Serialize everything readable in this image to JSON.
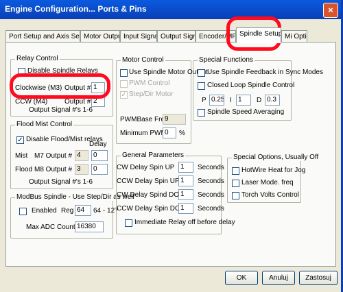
{
  "window": {
    "title": "Engine Configuration... Ports & Pins",
    "close_glyph": "×"
  },
  "tabs": [
    "Port Setup and Axis Selection",
    "Motor Outputs",
    "Input Signals",
    "Output Signals",
    "Encoder/MPG's",
    "Spindle Setup",
    "Mill Options"
  ],
  "tabs_visible": [
    "Port Setup and Axis Selection",
    "Motor Outputs",
    "Input Signals",
    "Output Signals",
    "Encoder/MP",
    "Spindle Setup",
    "Mi Options"
  ],
  "relay_control": {
    "title": "Relay Control",
    "disable_label": "Disable Spindle Relays",
    "cw_label": "Clockwise (M3)",
    "cw_output_label": "Output #",
    "cw_output_value": "1",
    "ccw_label": "CCW (M4)",
    "ccw_output_label": "Output #",
    "ccw_output_value": "2",
    "signals_label": "Output Signal #'s 1-6"
  },
  "flood_mist": {
    "title": "Flood Mist Control",
    "disable_label": "Disable Flood/Mist relays",
    "delay_label": "Delay",
    "mist_label": "Mist",
    "mist_code": "M7 Output #",
    "mist_output": "4",
    "mist_delay": "0",
    "flood_label": "Flood",
    "flood_code": "M8 Output #",
    "flood_output": "3",
    "flood_delay": "0",
    "signals_label": "Output Signal #'s 1-6"
  },
  "modbus": {
    "title": "ModBus Spindle - Use Step/Dir as well",
    "enabled_label": "Enabled",
    "reg_label": "Reg",
    "reg_value": "64",
    "reg_range": "64 - 127",
    "max_adc_label": "Max ADC Count",
    "max_adc_value": "16380"
  },
  "motor_control": {
    "title": "Motor Control",
    "use_motor_label": "Use Spindle Motor Output",
    "pwm_label": "PWM Control",
    "stepdir_label": "Step/Dir Motor",
    "pwm_base_label": "PWMBase Freq.",
    "pwm_base_value": "9",
    "min_pwm_label": "Minimum PWM",
    "min_pwm_value": "0",
    "min_pwm_unit": "%"
  },
  "special_functions": {
    "title": "Special Functions",
    "feedback_label": "Use Spindle Feedback in Sync Modes",
    "closed_loop_label": "Closed Loop Spindle Control",
    "p_label": "P",
    "p_value": "0.25",
    "i_label": "I",
    "i_value": "1",
    "d_label": "D",
    "d_value": "0.3",
    "averaging_label": "Spindle Speed Averaging"
  },
  "general_params": {
    "title": "General Parameters",
    "rows": [
      {
        "label": "CW Delay Spin UP",
        "value": "1",
        "unit": "Seconds"
      },
      {
        "label": "CCW Delay Spin UP",
        "value": "1",
        "unit": "Seconds"
      },
      {
        "label": "CW Delay Spind DOWN",
        "value": "1",
        "unit": "Seconds"
      },
      {
        "label": "CCW Delay Spin DOWN",
        "value": "1",
        "unit": "Seconds"
      }
    ],
    "immediate_label": "Immediate Relay off before delay"
  },
  "special_options": {
    "title": "Special Options, Usually Off",
    "hotwire_label": "HotWire Heat for Jog",
    "laser_label": "Laser Mode. freq",
    "torch_label": "Torch Volts Control"
  },
  "buttons": {
    "ok": "OK",
    "cancel": "Anuluj",
    "apply": "Zastosuj"
  },
  "colors": {
    "annotation": "#ff0a1e",
    "titlebar": "#0a3fb5",
    "dialog_bg": "#ECE9D8"
  }
}
